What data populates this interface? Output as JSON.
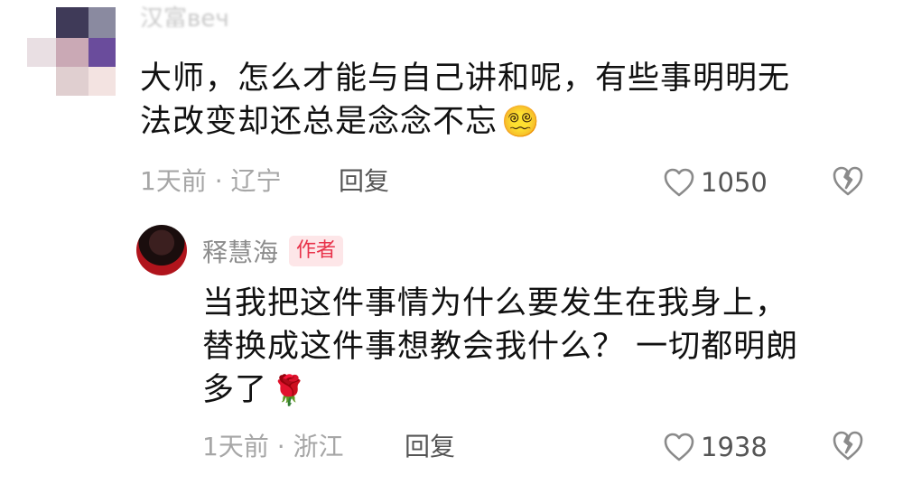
{
  "top_comment": {
    "username": "汉富веч",
    "text_line1": "大师，怎么才能与自己讲和呢，有些事明明无",
    "text_line2": "法改变却还总是念念不忘",
    "emoji": "😵‍💫",
    "time_location": "1天前 · 辽宁",
    "reply_label": "回复",
    "like_count": "1050"
  },
  "reply": {
    "author_name": "释慧海",
    "author_badge": "作者",
    "text_line1": "当我把这件事情为什么要发生在我身上，",
    "text_line2": "替换成这件事想教会我什么？ 一切都明朗",
    "text_line3": "多了",
    "emoji": "🌹",
    "time_location": "1天前 · 浙江",
    "reply_label": "回复",
    "like_count": "1938"
  },
  "icons": [
    "heart-outline-icon",
    "broken-heart-icon",
    "dizzy-face-emoji",
    "rose-emoji"
  ],
  "colors": {
    "badge_text": "#e8324a",
    "badge_bg": "#fde6e8",
    "meta_gray": "#a6a6a6",
    "body_text": "#111111"
  }
}
